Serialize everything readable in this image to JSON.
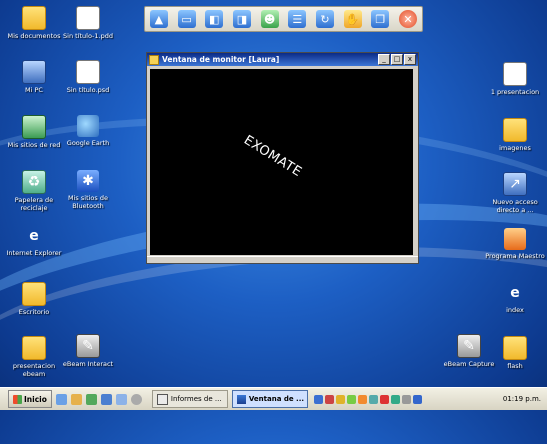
{
  "desktop": {
    "icons_left": [
      {
        "label": "Mis documentos",
        "icon": "folder-icon",
        "kind": "folder"
      },
      {
        "label": "Mi PC",
        "icon": "computer-icon",
        "kind": "pc"
      },
      {
        "label": "Mis sitios de red",
        "icon": "network-icon",
        "kind": "net"
      },
      {
        "label": "Papelera de reciclaje",
        "icon": "recycle-bin-icon",
        "kind": "trash"
      },
      {
        "label": "Internet Explorer",
        "icon": "internet-explorer-icon",
        "kind": "ie"
      },
      {
        "label": "Escritorio",
        "icon": "folder-icon",
        "kind": "folder"
      },
      {
        "label": "presentacion ebeam",
        "icon": "folder-icon",
        "kind": "folder"
      }
    ],
    "icons_col2": [
      {
        "label": "Sin título-1.pdd",
        "icon": "document-icon",
        "kind": "doc"
      },
      {
        "label": "Sin título.psd",
        "icon": "document-icon",
        "kind": "doc"
      },
      {
        "label": "Google Earth",
        "icon": "google-earth-icon",
        "kind": "earth"
      },
      {
        "label": "Mis sitios de Bluetooth",
        "icon": "bluetooth-icon",
        "kind": "bt"
      },
      {
        "label": "eBeam Interact",
        "icon": "ebeam-interact-icon",
        "kind": "ebeam"
      }
    ],
    "icons_right": [
      {
        "label": "1 presentacion",
        "icon": "document-icon",
        "kind": "doc"
      },
      {
        "label": "imagenes",
        "icon": "folder-icon",
        "kind": "folder"
      },
      {
        "label": "Nuevo acceso directo a ...",
        "icon": "shortcut-icon",
        "kind": "pc"
      },
      {
        "label": "Programa Maestro",
        "icon": "office-icon",
        "kind": "office"
      },
      {
        "label": "index",
        "icon": "internet-explorer-icon",
        "kind": "ie"
      },
      {
        "label": "flash",
        "icon": "folder-icon",
        "kind": "folder"
      }
    ],
    "ebeam_capture": {
      "label": "eBeam Capture",
      "icon": "ebeam-capture-icon"
    }
  },
  "toolbar": {
    "buttons": [
      {
        "name": "pointer-icon",
        "color": "blue",
        "glyph": "▲"
      },
      {
        "name": "monitor-icon",
        "color": "blue",
        "glyph": "▭"
      },
      {
        "name": "window-icon",
        "color": "blue",
        "glyph": "◧"
      },
      {
        "name": "window-group-icon",
        "color": "blue",
        "glyph": "◨"
      },
      {
        "name": "users-icon",
        "color": "green",
        "glyph": "☻"
      },
      {
        "name": "document-list-icon",
        "color": "blue",
        "glyph": "☰"
      },
      {
        "name": "refresh-icon",
        "color": "blue",
        "glyph": "↻"
      },
      {
        "name": "hand-icon",
        "color": "yellow",
        "glyph": "✋"
      },
      {
        "name": "files-icon",
        "color": "blue",
        "glyph": "❐"
      },
      {
        "name": "close-icon",
        "color": "red",
        "glyph": "✕"
      }
    ]
  },
  "window": {
    "title": "Ventana de monitor [Laura]",
    "minimize": "_",
    "maximize": "□",
    "close": "x",
    "screen_text": "EXOMATE"
  },
  "taskbar": {
    "start_label": "Inicio",
    "tasks": [
      {
        "label": "Informes de ...",
        "active": false
      },
      {
        "label": "Ventana de ...",
        "active": true
      }
    ],
    "clock": "01:19 p.m."
  }
}
